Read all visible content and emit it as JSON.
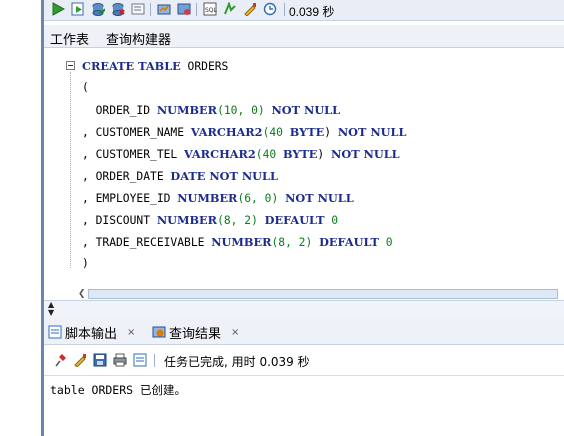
{
  "toolbar": {
    "timing": "0.039 秒",
    "icons": [
      "run-statement-icon",
      "run-script-icon",
      "commit-icon",
      "rollback-icon",
      "cancel-icon",
      "autotrace-icon",
      "explain-plan-icon",
      "sql-tuning-icon",
      "format-icon",
      "clear-icon",
      "history-icon"
    ]
  },
  "editor_tabs": {
    "worksheet": "工作表",
    "query_builder": "查询构建器"
  },
  "code": {
    "l1_kw": "CREATE TABLE",
    "l1_name": " ORDERS",
    "l2": "(",
    "l3_col": "  ORDER_ID ",
    "l3_type": "NUMBER",
    "l3_args": "(10, 0)",
    "l3_null": "NOT NULL",
    "l4_col": ", CUSTOMER_NAME ",
    "l4_type": "VARCHAR2",
    "l4_args": "(40 ",
    "l4_byte": "BYTE",
    "l4_close": ") ",
    "l4_null": "NOT NULL",
    "l5_col": ", CUSTOMER_TEL ",
    "l5_type": "VARCHAR2",
    "l5_args": "(40 ",
    "l5_byte": "BYTE",
    "l5_close": ") ",
    "l5_null": "NOT NULL",
    "l6_col": ", ORDER_DATE ",
    "l6_type": "DATE NOT NULL",
    "l7_col": ", EMPLOYEE_ID ",
    "l7_type": "NUMBER",
    "l7_args": "(6, 0) ",
    "l7_null": "NOT NULL",
    "l8_col": ", DISCOUNT ",
    "l8_type": "NUMBER",
    "l8_args": "(8, 2) ",
    "l8_default": "DEFAULT",
    "l8_val": " 0",
    "l9_col": ", TRADE_RECEIVABLE ",
    "l9_type": "NUMBER",
    "l9_args": "(8, 2) ",
    "l9_default": "DEFAULT",
    "l9_val": " 0",
    "l10": ")"
  },
  "output_tabs": {
    "script_output": "脚本输出",
    "query_result": "查询结果",
    "close": "×"
  },
  "output_toolbar": {
    "status": "任务已完成, 用时 0.039 秒"
  },
  "output": {
    "message": "table ORDERS 已创建。"
  },
  "colors": {
    "keyword": "#1b2b8e",
    "number": "#0a7d18",
    "accent": "#6b86ad"
  }
}
